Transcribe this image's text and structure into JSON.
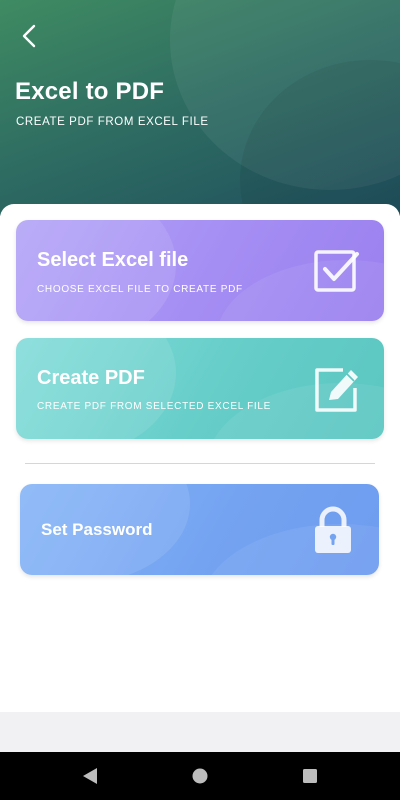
{
  "header": {
    "title": "Excel to PDF",
    "subtitle": "CREATE PDF FROM EXCEL FILE",
    "back_icon": "chevron-left-icon",
    "gradient_colors": [
      "#3f8b62",
      "#1f4f5e"
    ]
  },
  "cards": [
    {
      "title": "Select Excel file",
      "subtitle": "CHOOSE EXCEL FILE TO CREATE PDF",
      "icon": "checkbox-icon",
      "color": "#a48df3"
    },
    {
      "title": "Create PDF",
      "subtitle": "CREATE PDF FROM SELECTED EXCEL FILE",
      "icon": "edit-icon",
      "color": "#66cdc8"
    },
    {
      "title": "Set Password",
      "icon": "lock-icon",
      "color": "#74a3f1"
    }
  ],
  "navbar": {
    "buttons": [
      "back-nav-icon",
      "home-nav-icon",
      "recents-nav-icon"
    ]
  }
}
